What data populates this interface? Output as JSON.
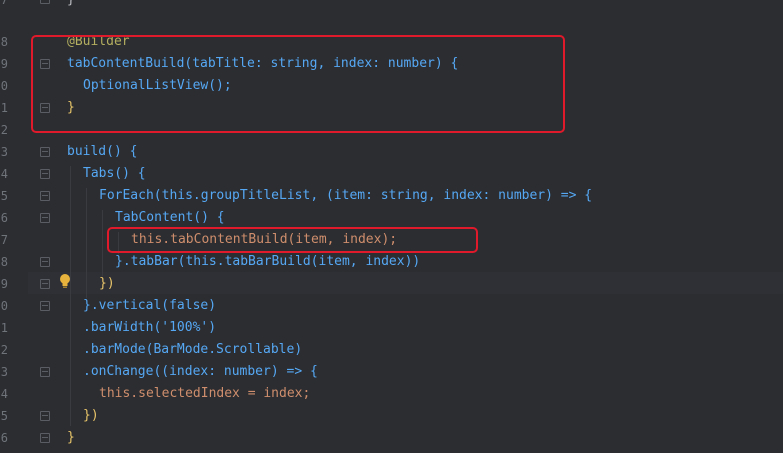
{
  "editor": {
    "line_numbers": [
      "7",
      "8",
      "9",
      "0",
      "1",
      "2",
      "3",
      "4",
      "5",
      "6",
      "7",
      "8",
      "9",
      "0",
      "1",
      "2",
      "3",
      "4",
      "5",
      "6"
    ],
    "lines": [
      "}",
      "@Builder",
      "tabContentBuild(tabTitle: string, index: number) {",
      "OptionalListView();",
      "}",
      "",
      "build() {",
      "Tabs() {",
      "ForEach(this.groupTitleList, (item: string, index: number) => {",
      "TabContent() {",
      "this.tabContentBuild(item, index);",
      "}.tabBar(this.tabBarBuild(item, index))",
      "})",
      "}.vertical(false)",
      ".barWidth('100%')",
      ".barMode(BarMode.Scrollable)",
      ".onChange((index: number) => {",
      "this.selectedIndex = index;",
      "})",
      "}"
    ]
  },
  "icons": {
    "bulb": "lightbulb-icon",
    "fold": "fold-marker-icon"
  },
  "colors": {
    "background": "#2b2d30",
    "keyword": "#cf8e6d",
    "function": "#56a8f5",
    "string": "#6aab73",
    "annotation": "#b3ae60",
    "highlight_box": "#e0192b"
  }
}
